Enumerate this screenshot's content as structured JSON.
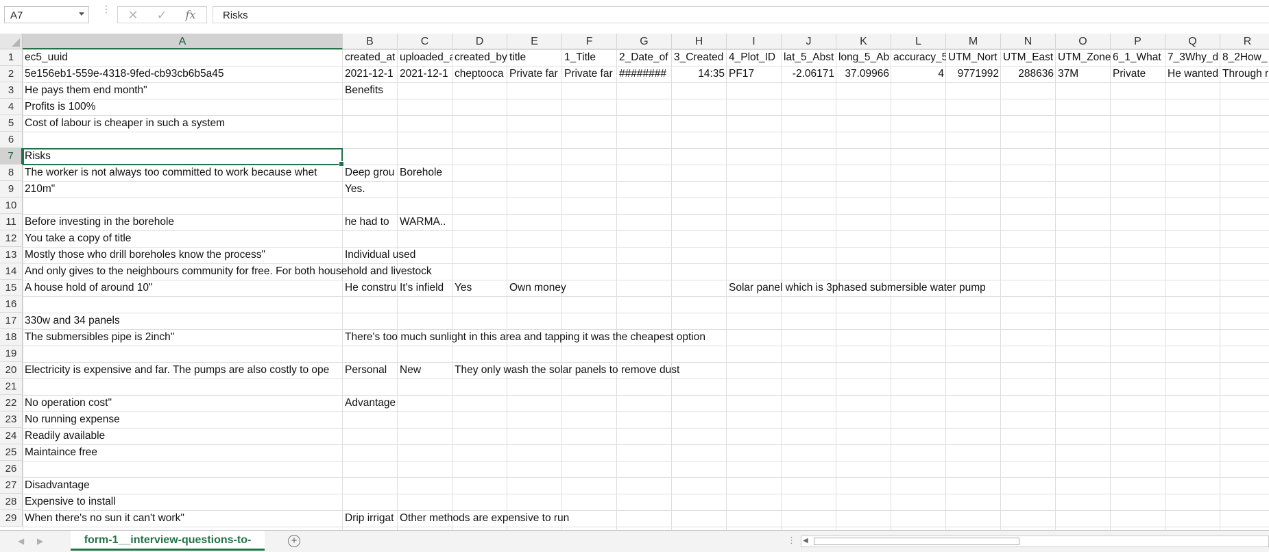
{
  "formula_bar": {
    "name_box": "A7",
    "formula": "Risks",
    "cancel_glyph": "✕",
    "enter_glyph": "✓",
    "fx_glyph": "fx"
  },
  "columns": [
    "A",
    "B",
    "C",
    "D",
    "E",
    "F",
    "G",
    "H",
    "I",
    "J",
    "K",
    "L",
    "M",
    "N",
    "O",
    "P",
    "Q",
    "R"
  ],
  "rows": [
    "1",
    "2",
    "3",
    "4",
    "5",
    "6",
    "7",
    "8",
    "9",
    "10",
    "11",
    "12",
    "13",
    "14",
    "15",
    "16",
    "17",
    "18",
    "19",
    "20",
    "21",
    "22",
    "23",
    "24",
    "25",
    "26",
    "27",
    "28",
    "29"
  ],
  "cells": [
    {
      "ref": "A1",
      "text": "ec5_uuid"
    },
    {
      "ref": "B1",
      "text": "created_at"
    },
    {
      "ref": "C1",
      "text": "uploaded_at"
    },
    {
      "ref": "D1",
      "text": "created_by"
    },
    {
      "ref": "E1",
      "text": "title"
    },
    {
      "ref": "F1",
      "text": "1_Title"
    },
    {
      "ref": "G1",
      "text": "2_Date_of"
    },
    {
      "ref": "H1",
      "text": "3_Created"
    },
    {
      "ref": "I1",
      "text": "4_Plot_ID"
    },
    {
      "ref": "J1",
      "text": "lat_5_Abst"
    },
    {
      "ref": "K1",
      "text": "long_5_Ab"
    },
    {
      "ref": "L1",
      "text": "accuracy_5"
    },
    {
      "ref": "M1",
      "text": "UTM_Nort"
    },
    {
      "ref": "N1",
      "text": "UTM_East"
    },
    {
      "ref": "O1",
      "text": "UTM_Zone"
    },
    {
      "ref": "P1",
      "text": "6_1_What"
    },
    {
      "ref": "Q1",
      "text": "7_3Why_d"
    },
    {
      "ref": "R1",
      "text": "8_2How_"
    },
    {
      "ref": "A2",
      "text": "5e156eb1-559e-4318-9fed-cb93cb6b5a45"
    },
    {
      "ref": "B2",
      "text": "2021-12-1"
    },
    {
      "ref": "C2",
      "text": "2021-12-1"
    },
    {
      "ref": "D2",
      "text": "cheptooca"
    },
    {
      "ref": "E2",
      "text": "Private far"
    },
    {
      "ref": "F2",
      "text": "Private far"
    },
    {
      "ref": "G2",
      "text": "########"
    },
    {
      "ref": "H2",
      "text": "14:35",
      "num": true
    },
    {
      "ref": "I2",
      "text": "PF17"
    },
    {
      "ref": "J2",
      "text": "-2.06171",
      "num": true
    },
    {
      "ref": "K2",
      "text": "37.09966",
      "num": true
    },
    {
      "ref": "L2",
      "text": "4",
      "num": true
    },
    {
      "ref": "M2",
      "text": "9771992",
      "num": true
    },
    {
      "ref": "N2",
      "text": "288636",
      "num": true
    },
    {
      "ref": "O2",
      "text": "37M"
    },
    {
      "ref": "P2",
      "text": "Private"
    },
    {
      "ref": "Q2",
      "text": "He wanted"
    },
    {
      "ref": "R2",
      "text": "Through r"
    },
    {
      "ref": "A3",
      "text": "He pays them end month\""
    },
    {
      "ref": "B3",
      "text": "Benefits"
    },
    {
      "ref": "A4",
      "text": "Profits is 100%"
    },
    {
      "ref": "A5",
      "text": "Cost of labour is cheaper in such a system"
    },
    {
      "ref": "A7",
      "text": "Risks"
    },
    {
      "ref": "A8",
      "text": "The worker is not always too committed to work because whet"
    },
    {
      "ref": "B8",
      "text": "Deep grou"
    },
    {
      "ref": "C8",
      "text": "Borehole"
    },
    {
      "ref": "A9",
      "text": "210m\""
    },
    {
      "ref": "B9",
      "text": "Yes."
    },
    {
      "ref": "A11",
      "text": "Before investing in the borehole"
    },
    {
      "ref": "B11",
      "text": " he had to"
    },
    {
      "ref": "C11",
      "text": " WARMA.."
    },
    {
      "ref": "A12",
      "text": "You take a copy of title"
    },
    {
      "ref": "A13",
      "text": "Mostly those who drill boreholes know the process\""
    },
    {
      "ref": "B13",
      "text": "Individual used",
      "spill": true
    },
    {
      "ref": "A14",
      "text": "And only gives to the neighbours community for free. For both household and livestock",
      "spill": true
    },
    {
      "ref": "A15",
      "text": "A house hold of around 10\""
    },
    {
      "ref": "B15",
      "text": "He constru"
    },
    {
      "ref": "C15",
      "text": "It's infield"
    },
    {
      "ref": "D15",
      "text": "Yes"
    },
    {
      "ref": "E15",
      "text": "Own money",
      "spill": true
    },
    {
      "ref": "I15",
      "text": "Solar panel which is 3phased submersible water pump",
      "spill": true
    },
    {
      "ref": "A17",
      "text": "330w and 34 panels"
    },
    {
      "ref": "A18",
      "text": "The submersibles pipe is 2inch\""
    },
    {
      "ref": "B18",
      "text": "There's too much sunlight in this area and tapping it was the cheapest option",
      "spill": true
    },
    {
      "ref": "A20",
      "text": "Electricity is expensive and far. The pumps are also costly to ope"
    },
    {
      "ref": "B20",
      "text": "Personal"
    },
    {
      "ref": "C20",
      "text": "New"
    },
    {
      "ref": "D20",
      "text": "They only wash the solar panels to remove dust",
      "spill": true
    },
    {
      "ref": "A22",
      "text": "No operation cost\""
    },
    {
      "ref": "B22",
      "text": "Advantage"
    },
    {
      "ref": "A23",
      "text": "No running expense"
    },
    {
      "ref": "A24",
      "text": "Readily available"
    },
    {
      "ref": "A25",
      "text": "Maintaince free"
    },
    {
      "ref": "A27",
      "text": "Disadvantage"
    },
    {
      "ref": "A28",
      "text": "Expensive to install"
    },
    {
      "ref": "A29",
      "text": "When there's no sun it can't work\""
    },
    {
      "ref": "B29",
      "text": "Drip irrigat"
    },
    {
      "ref": "C29",
      "text": "Other methods are expensive to run",
      "spill": true
    }
  ],
  "active_cell": "A7",
  "sheet_tab": {
    "label": "form-1__interview-questions-to-",
    "add_glyph": "+"
  },
  "icons": [
    "namebox-dropdown-icon",
    "cancel-icon",
    "enter-icon",
    "function-icon",
    "sheet-prev-icon",
    "sheet-next-icon",
    "add-sheet-icon"
  ]
}
